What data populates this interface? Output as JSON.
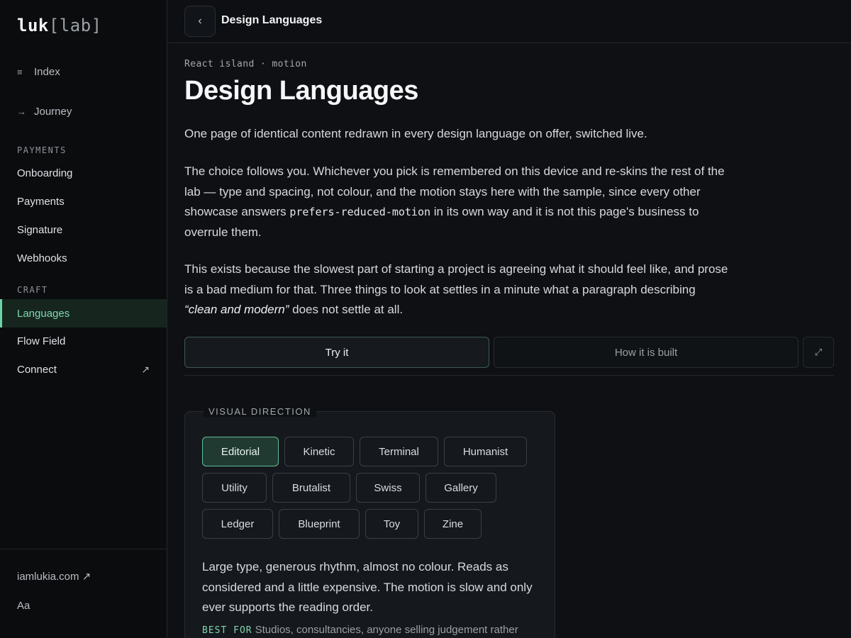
{
  "logo": {
    "main": "luk",
    "bracket": "[lab]"
  },
  "sidebar": {
    "top_items": [
      {
        "icon": "≡",
        "label": "Index"
      },
      {
        "icon": "→",
        "label": "Journey"
      }
    ],
    "sections": [
      {
        "label": "PAYMENTS",
        "items": [
          "Onboarding",
          "Payments",
          "Signature",
          "Webhooks"
        ]
      },
      {
        "label": "CRAFT",
        "items": [
          "Languages",
          "Flow Field",
          "Connect"
        ]
      }
    ],
    "active_item": "Languages",
    "connect_arrow": "↗",
    "footer": {
      "site": "iamlukia.com ↗",
      "font_toggle": "Aa"
    }
  },
  "header": {
    "back_icon": "‹",
    "title": "Design Languages"
  },
  "main": {
    "kicker": "React island · motion",
    "title": "Design Languages",
    "p1": "One page of identical content redrawn in every design language on offer, switched live.",
    "p2_before": "The choice follows you. Whichever you pick is remembered on this device and re-skins the rest of the lab — type and spacing, not colour, and the motion stays here with the sample, since every other showcase answers ",
    "p2_code": "prefers-reduced-motion",
    "p2_after": " in its own way and it is not this page's business to overrule them.",
    "p3_before": "This exists because the slowest part of starting a project is agreeing what it should feel like, and prose is a bad medium for that. Three things to look at settles in a minute what a paragraph describing ",
    "p3_em": "“clean and modern”",
    "p3_after": " does not settle at all.",
    "tabs": {
      "try": "Try it",
      "how": "How it is built",
      "expand_icon": "⤢"
    },
    "panel": {
      "legend": "VISUAL DIRECTION",
      "options": [
        "Editorial",
        "Kinetic",
        "Terminal",
        "Humanist",
        "Utility",
        "Brutalist",
        "Swiss",
        "Gallery",
        "Ledger",
        "Blueprint",
        "Toy",
        "Zine"
      ],
      "selected": "Editorial",
      "description": "Large type, generous rhythm, almost no colour. Reads as considered and a little expensive. The motion is slow and only ever supports the reading order.",
      "best_for_label": "BEST FOR",
      "best_for_text": "Studios, consultancies, anyone selling judgement rather"
    }
  },
  "colors": {
    "accent": "#6fd3a8",
    "background": "#0e1013",
    "sidebar": "#0b0c0e"
  }
}
